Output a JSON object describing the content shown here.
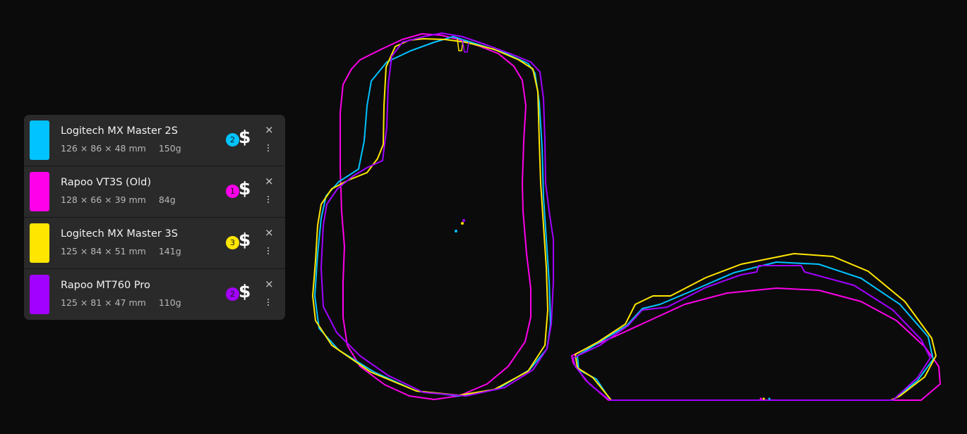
{
  "mice": [
    {
      "name": "Logitech MX Master 2S",
      "dims": "126 × 86 × 48 mm",
      "weight": "150g",
      "price_tier": "2",
      "price_symbol": "$",
      "color": "#00c3ff"
    },
    {
      "name": "Rapoo VT3S (Old)",
      "dims": "128 × 66 × 39 mm",
      "weight": "84g",
      "price_tier": "1",
      "price_symbol": "$",
      "color": "#ff00ea"
    },
    {
      "name": "Logitech MX Master 3S",
      "dims": "125 × 84 × 51 mm",
      "weight": "141g",
      "price_tier": "3",
      "price_symbol": "$",
      "color": "#ffe600"
    },
    {
      "name": "Rapoo MT760 Pro",
      "dims": "125 × 81 × 47 mm",
      "weight": "110g",
      "price_tier": "2",
      "price_symbol": "$",
      "color": "#a200ff"
    }
  ],
  "controls": {
    "remove_label": "×"
  },
  "views": {
    "top_view": "top-outline",
    "side_view": "side-outline"
  }
}
